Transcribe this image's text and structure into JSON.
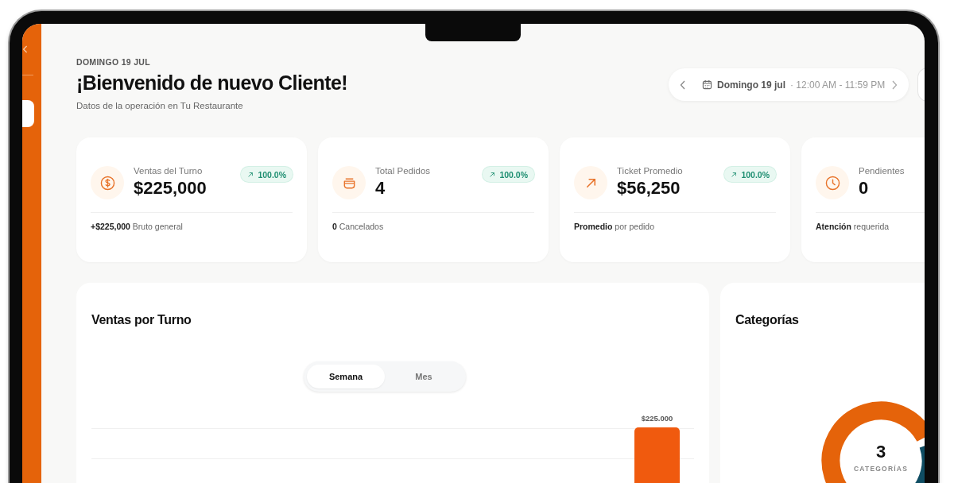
{
  "date_label": "DOMINGO 19 JUL",
  "title": "¡Bienvenido de nuevo Cliente!",
  "subtitle": "Datos de la operación en Tu Restaurante",
  "date_picker": {
    "date": "Domingo 19 jul",
    "time_range": "· 12:00 AM - 11:59 PM"
  },
  "stats": [
    {
      "kind": "dollar",
      "label": "Ventas del Turno",
      "value": "$225,000",
      "badge": "100.0%",
      "footer": "**+$225,000** Bruto general"
    },
    {
      "kind": "pot",
      "label": "Total Pedidos",
      "value": "4",
      "badge": "100.0%",
      "footer": "**0** Cancelados"
    },
    {
      "kind": "trend",
      "label": "Ticket Promedio",
      "value": "$56,250",
      "badge": "100.0%",
      "footer": "**Promedio** por pedido"
    },
    {
      "kind": "clock",
      "label": "Pendientes",
      "value": "0",
      "footer": "**Atención** requerida"
    }
  ],
  "sales_panel": {
    "title": "Ventas por Turno",
    "tabs": [
      {
        "label": "Semana",
        "selected": true
      },
      {
        "label": "Mes",
        "selected": false
      }
    ],
    "bar_label": "$225.000"
  },
  "categories_panel": {
    "title": "Categorías",
    "count": "3",
    "count_label": "CATEGORÍAS"
  }
}
